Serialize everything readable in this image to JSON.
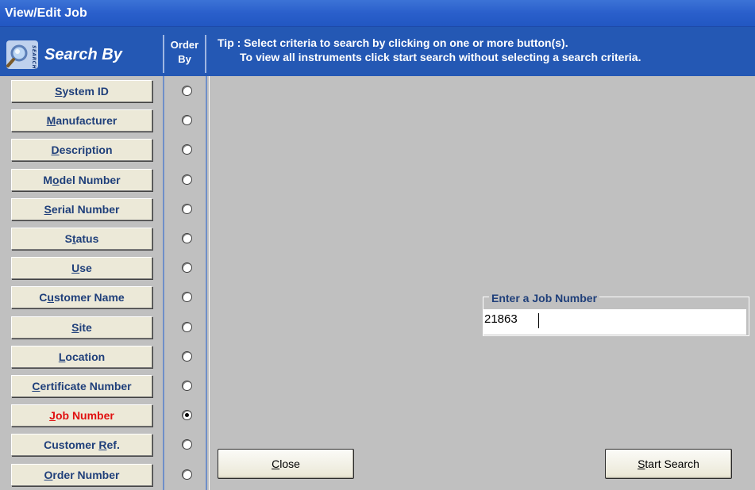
{
  "window": {
    "title": "View/Edit Job"
  },
  "header": {
    "search_by_label": "Search By",
    "logo_text": "SEARCH",
    "order_by_line1": "Order",
    "order_by_line2": "By",
    "tip_line1": "Tip : Select criteria to search by clicking on one or more button(s).",
    "tip_line2": "To view all instruments click start search without selecting a search criteria."
  },
  "criteria": [
    {
      "pre": "",
      "key": "S",
      "post": "ystem ID",
      "selected": false
    },
    {
      "pre": "",
      "key": "M",
      "post": "anufacturer",
      "selected": false
    },
    {
      "pre": "",
      "key": "D",
      "post": "escription",
      "selected": false
    },
    {
      "pre": "M",
      "key": "o",
      "post": "del Number",
      "selected": false
    },
    {
      "pre": "",
      "key": "S",
      "post": "erial Number",
      "selected": false
    },
    {
      "pre": "S",
      "key": "t",
      "post": "atus",
      "selected": false
    },
    {
      "pre": "",
      "key": "U",
      "post": "se",
      "selected": false
    },
    {
      "pre": "C",
      "key": "u",
      "post": "stomer Name",
      "selected": false
    },
    {
      "pre": "",
      "key": "S",
      "post": "ite",
      "selected": false
    },
    {
      "pre": "",
      "key": "L",
      "post": "ocation",
      "selected": false
    },
    {
      "pre": "",
      "key": "C",
      "post": "ertificate Number",
      "selected": false
    },
    {
      "pre": "",
      "key": "J",
      "post": "ob Number",
      "selected": true
    },
    {
      "pre": "Customer ",
      "key": "R",
      "post": "ef.",
      "selected": false
    },
    {
      "pre": "",
      "key": "O",
      "post": "rder Number",
      "selected": false
    }
  ],
  "job_search": {
    "label": "Enter a Job Number",
    "value": "21863"
  },
  "buttons": {
    "close_key": "C",
    "close_rest": "lose",
    "start_key": "S",
    "start_rest": "tart Search"
  },
  "colors": {
    "titlebar": "#2a5fcb",
    "header": "#2458b4",
    "active_criteria": "#e01010",
    "criteria_text": "#1f3f7a"
  }
}
